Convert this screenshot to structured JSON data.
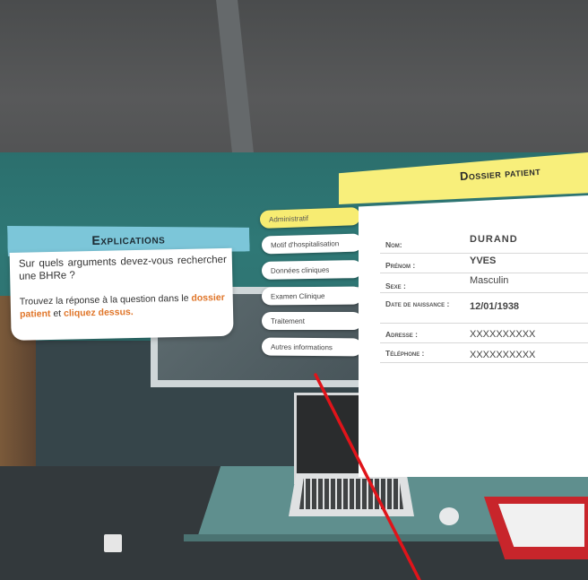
{
  "explications": {
    "title": "Explications",
    "question": "Sur quels arguments devez-vous rechercher une BHRe ?",
    "instruction_prefix": "Trouvez la réponse à la question dans le",
    "instruction_highlight_1": "dossier patient",
    "instruction_middle": "et",
    "instruction_highlight_2": "cliquez dessus."
  },
  "tabs": [
    {
      "label": "Administratif",
      "active": true
    },
    {
      "label": "Motif d'hospitalisation",
      "active": false
    },
    {
      "label": "Données cliniques",
      "active": false
    },
    {
      "label": "Examen Clinique",
      "active": false
    },
    {
      "label": "Traitement",
      "active": false
    },
    {
      "label": "Autres informations",
      "active": false
    }
  ],
  "dossier": {
    "title": "Dossier patient",
    "rows": [
      {
        "label": "Nom:",
        "value": "DURAND"
      },
      {
        "label": "Prénom :",
        "value": "YVES"
      },
      {
        "label": "Sexe :",
        "value": "Masculin"
      },
      {
        "label": "Date de naissance :",
        "value": "12/01/1938"
      },
      {
        "label": "Adresse :",
        "value": "XXXXXXXXXX"
      },
      {
        "label": "Téléphone :",
        "value": "XXXXXXXXXX"
      }
    ]
  },
  "colors": {
    "explications_header": "#7cc6d9",
    "dossier_header": "#f8ef7b",
    "active_tab": "#f7ec72",
    "highlight": "#e0762a",
    "laser": "#e0141a"
  }
}
